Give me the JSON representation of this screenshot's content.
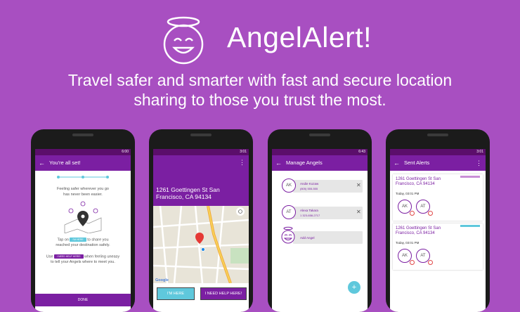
{
  "hero": {
    "title": "AngelAlert!",
    "tagline_line1": "Travel safer and smarter with fast and secure location",
    "tagline_line2": "sharing to those you trust the most."
  },
  "phone1": {
    "time": "6:00",
    "title": "You're all set!",
    "line1": "Feeling safer wherever you go",
    "line2": "has never been easier.",
    "tap_prefix": "Tap on",
    "tap_pill": "I'M HERE",
    "tap_suffix": "to share you",
    "tap_line2": "reached your destination safely.",
    "use_prefix": "Use",
    "use_pill": "I NEED HELP HERE!",
    "use_suffix": "when feeling uneasy",
    "use_line2": "to tell your Angels where to meet you.",
    "done": "DONE"
  },
  "phone2": {
    "time": "3:01",
    "address_line1": "1261 Goettingen St San",
    "address_line2": "Francisco, CA 94134",
    "im_here": "I'M HERE",
    "need_help": "I NEED HELP HERE!",
    "map_badge": "Google"
  },
  "phone3": {
    "time": "6:43",
    "title": "Manage Angels",
    "angels": [
      {
        "initials": "AK",
        "name": "Andie Kozaw",
        "phone": "(805) 555-555"
      },
      {
        "initials": "AT",
        "name": "Alexa Takara",
        "phone": "1 323-658-2717"
      }
    ],
    "add_label": "Add Angel",
    "fab": "+"
  },
  "phone4": {
    "time": "3:01",
    "title": "Sent Alerts",
    "alerts": [
      {
        "address_line1": "1261 Goettingen St San",
        "address_line2": "Francisco, CA 94134",
        "time": "Today, 03:01 PM",
        "a1": "AK",
        "a2": "AT",
        "bar_color": "#c98fd6"
      },
      {
        "address_line1": "1261 Goettingen St San",
        "address_line2": "Francisco, CA 94134",
        "time": "Today, 03:01 PM",
        "a1": "AK",
        "a2": "AT",
        "bar_color": "#5fc8dc"
      }
    ]
  },
  "icons": {
    "logo": "angel-smiley-icon",
    "back": "arrow-left-icon",
    "more": "more-vert-icon",
    "close": "close-icon",
    "location": "my-location-icon",
    "pin": "map-pin-icon"
  },
  "colors": {
    "background": "#a84fc1",
    "primary": "#7b1fa2",
    "accent": "#5fc8dc"
  }
}
